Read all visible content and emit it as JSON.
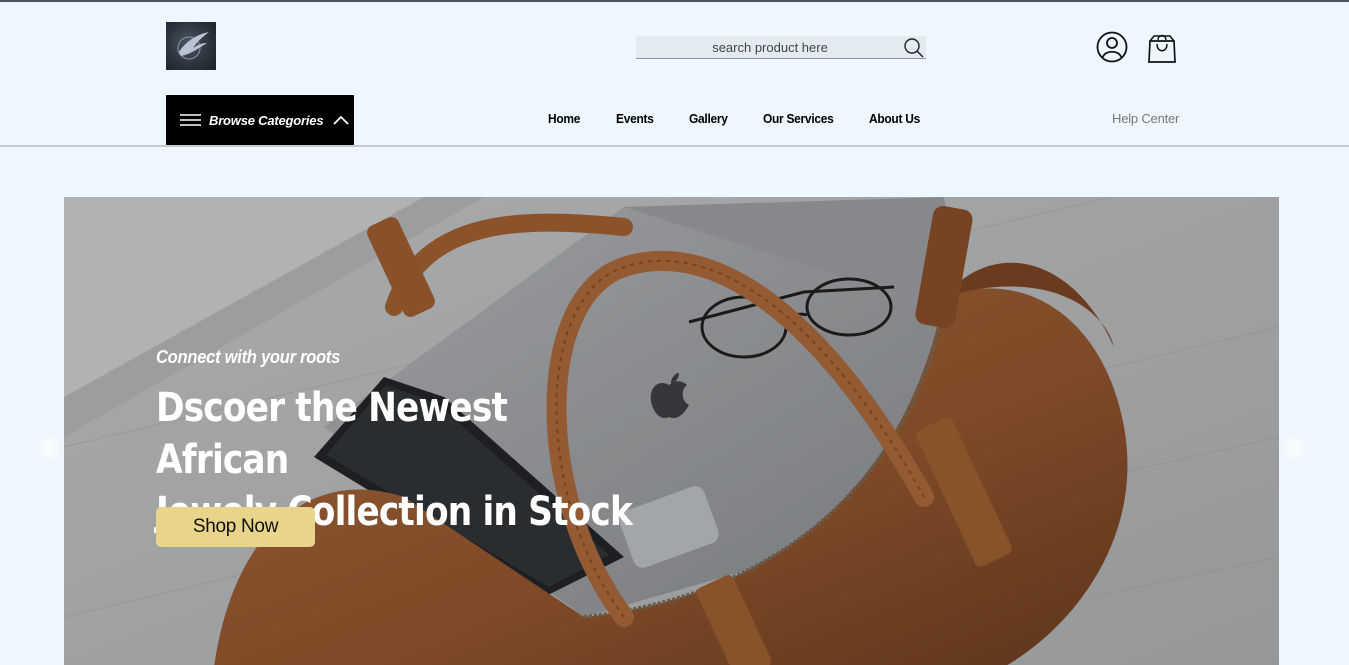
{
  "header": {
    "search": {
      "placeholder": "search product here"
    },
    "browse_label": "Browse Categories",
    "nav": [
      "Home",
      "Events",
      "Gallery",
      "Our Services",
      "About Us"
    ],
    "help_label": "Help Center"
  },
  "hero": {
    "tagline": "Connect with your roots",
    "headline_line1": "Dscoer the Newest African",
    "headline_line2": "Jewely Collection in Stock",
    "cta_label": "Shop Now"
  },
  "icons": {
    "logo": "wing-logo",
    "search": "search-icon",
    "user": "user-icon",
    "cart": "shopping-bag-icon",
    "menu": "menu-lines-icon",
    "chevron": "chevron-up-icon",
    "prev": "chevron-left-icon",
    "next": "chevron-right-icon"
  }
}
